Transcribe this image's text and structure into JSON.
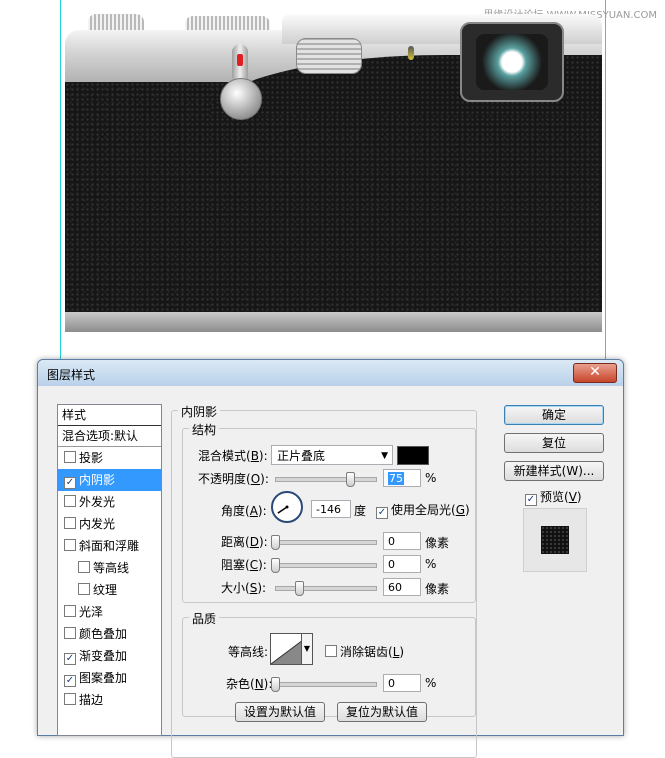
{
  "watermark": "思缘设计论坛 WWW.MISSYUAN.COM",
  "dialog": {
    "title": "图层样式",
    "close_symbol": "✕",
    "styles_panel": {
      "header": "样式",
      "blend_options": "混合选项:默认",
      "items": [
        {
          "label": "投影",
          "checked": false,
          "selected": false,
          "indent": false
        },
        {
          "label": "内阴影",
          "checked": true,
          "selected": true,
          "indent": false
        },
        {
          "label": "外发光",
          "checked": false,
          "selected": false,
          "indent": false
        },
        {
          "label": "内发光",
          "checked": false,
          "selected": false,
          "indent": false
        },
        {
          "label": "斜面和浮雕",
          "checked": false,
          "selected": false,
          "indent": false
        },
        {
          "label": "等高线",
          "checked": false,
          "selected": false,
          "indent": true
        },
        {
          "label": "纹理",
          "checked": false,
          "selected": false,
          "indent": true
        },
        {
          "label": "光泽",
          "checked": false,
          "selected": false,
          "indent": false
        },
        {
          "label": "颜色叠加",
          "checked": false,
          "selected": false,
          "indent": false
        },
        {
          "label": "渐变叠加",
          "checked": true,
          "selected": false,
          "indent": false
        },
        {
          "label": "图案叠加",
          "checked": true,
          "selected": false,
          "indent": false
        },
        {
          "label": "描边",
          "checked": false,
          "selected": false,
          "indent": false
        }
      ]
    },
    "inner_shadow": {
      "section_title": "内阴影",
      "structure_title": "结构",
      "blend_mode": {
        "label": "混合模式(",
        "key": "B",
        "suffix": "):",
        "value": "正片叠底",
        "color": "#000000"
      },
      "opacity": {
        "label": "不透明度(",
        "key": "O",
        "suffix": "):",
        "value": "75",
        "unit": "%",
        "fraction": 0.75
      },
      "angle": {
        "label": "角度(",
        "key": "A",
        "suffix": "):",
        "value": "-146",
        "unit": "度",
        "degrees": -146
      },
      "global_light": {
        "label": "使用全局光(",
        "key": "G",
        "suffix": ")",
        "checked": true
      },
      "distance": {
        "label": "距离(",
        "key": "D",
        "suffix": "):",
        "value": "0",
        "unit": "像素",
        "fraction": 0
      },
      "choke": {
        "label": "阻塞(",
        "key": "C",
        "suffix": "):",
        "value": "0",
        "unit": "%",
        "fraction": 0
      },
      "size": {
        "label": "大小(",
        "key": "S",
        "suffix": "):",
        "value": "60",
        "unit": "像素",
        "fraction": 0.24
      }
    },
    "quality": {
      "title": "品质",
      "contour": {
        "label": "等高线:"
      },
      "antialias": {
        "label": "消除锯齿(",
        "key": "L",
        "suffix": ")",
        "checked": false
      },
      "noise": {
        "label": "杂色(",
        "key": "N",
        "suffix": "):",
        "value": "0",
        "unit": "%",
        "fraction": 0
      }
    },
    "buttons": {
      "set_default": "设置为默认值",
      "reset_default": "复位为默认值",
      "ok": "确定",
      "reset": "复位",
      "new_style": "新建样式(W)...",
      "preview": {
        "label": "预览(",
        "key": "V",
        "suffix": ")",
        "checked": true
      }
    }
  }
}
